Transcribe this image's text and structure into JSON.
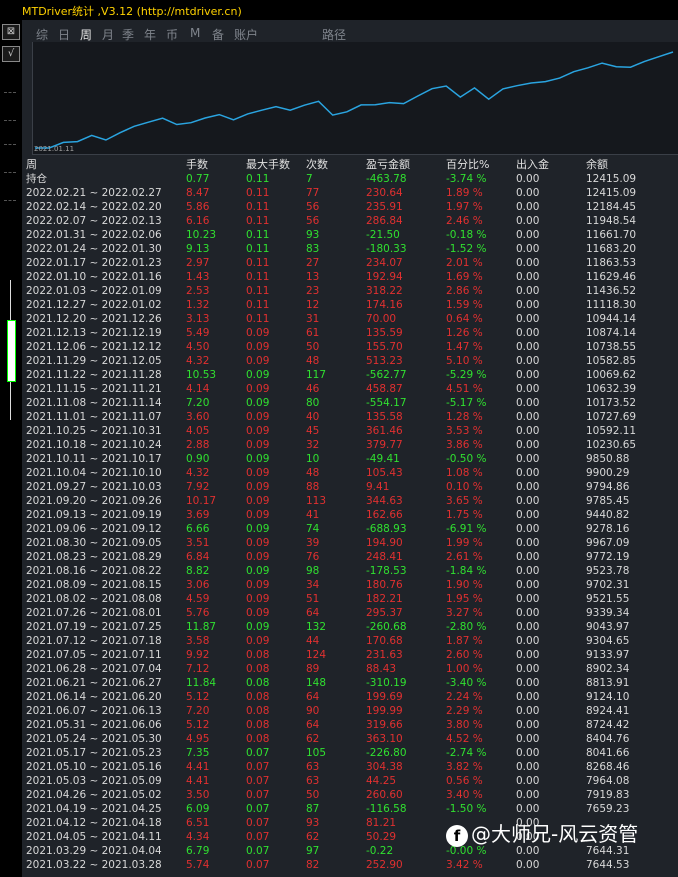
{
  "title": "MTDriver统计 ,V3.12 (http://mtdriver.cn)",
  "tabs": [
    "综",
    "日",
    "周",
    "月",
    "季",
    "年",
    "币",
    "M",
    "备",
    "账户",
    "路径"
  ],
  "active_tab": "周",
  "chart": {
    "x_label": "2021.01.11",
    "line_color": "#2aa4e0",
    "values": [
      7644.53,
      7644.31,
      7919.83,
      7964.08,
      8268.46,
      8041.66,
      8404.76,
      8724.42,
      8924.41,
      9124.1,
      8813.91,
      8902.34,
      9133.97,
      9304.65,
      9043.97,
      9339.34,
      9521.55,
      9702.31,
      9523.78,
      9772.19,
      9967.09,
      9278.16,
      9440.82,
      9785.45,
      9794.86,
      9900.29,
      9850.88,
      10230.65,
      10592.11,
      10727.69,
      10173.52,
      10632.39,
      10069.62,
      10582.85,
      10738.55,
      10874.14,
      10944.14,
      11118.3,
      11436.52,
      11629.46,
      11863.53,
      11683.2,
      11661.7,
      11948.54,
      12184.45,
      12415.09
    ]
  },
  "columns": [
    "周",
    "手数",
    "最大手数",
    "次数",
    "盈亏金额",
    "百分比%",
    "出入金",
    "余额"
  ],
  "holding": {
    "label": "持仓",
    "lots": "0.77",
    "max_lots": "0.11",
    "count": "7",
    "pnl": "-463.78",
    "pct": "-3.74 %",
    "inout": "0.00",
    "balance": "12415.09"
  },
  "rows": [
    {
      "period": "2022.02.21 ~ 2022.02.27",
      "lots": "8.47",
      "max_lots": "0.11",
      "count": "77",
      "pnl": "230.64",
      "pct": "1.89 %",
      "inout": "0.00",
      "balance": "12415.09"
    },
    {
      "period": "2022.02.14 ~ 2022.02.20",
      "lots": "5.86",
      "max_lots": "0.11",
      "count": "56",
      "pnl": "235.91",
      "pct": "1.97 %",
      "inout": "0.00",
      "balance": "12184.45"
    },
    {
      "period": "2022.02.07 ~ 2022.02.13",
      "lots": "6.16",
      "max_lots": "0.11",
      "count": "56",
      "pnl": "286.84",
      "pct": "2.46 %",
      "inout": "0.00",
      "balance": "11948.54"
    },
    {
      "period": "2022.01.31 ~ 2022.02.06",
      "lots": "10.23",
      "max_lots": "0.11",
      "count": "93",
      "pnl": "-21.50",
      "pct": "-0.18 %",
      "inout": "0.00",
      "balance": "11661.70"
    },
    {
      "period": "2022.01.24 ~ 2022.01.30",
      "lots": "9.13",
      "max_lots": "0.11",
      "count": "83",
      "pnl": "-180.33",
      "pct": "-1.52 %",
      "inout": "0.00",
      "balance": "11683.20"
    },
    {
      "period": "2022.01.17 ~ 2022.01.23",
      "lots": "2.97",
      "max_lots": "0.11",
      "count": "27",
      "pnl": "234.07",
      "pct": "2.01 %",
      "inout": "0.00",
      "balance": "11863.53"
    },
    {
      "period": "2022.01.10 ~ 2022.01.16",
      "lots": "1.43",
      "max_lots": "0.11",
      "count": "13",
      "pnl": "192.94",
      "pct": "1.69 %",
      "inout": "0.00",
      "balance": "11629.46"
    },
    {
      "period": "2022.01.03 ~ 2022.01.09",
      "lots": "2.53",
      "max_lots": "0.11",
      "count": "23",
      "pnl": "318.22",
      "pct": "2.86 %",
      "inout": "0.00",
      "balance": "11436.52"
    },
    {
      "period": "2021.12.27 ~ 2022.01.02",
      "lots": "1.32",
      "max_lots": "0.11",
      "count": "12",
      "pnl": "174.16",
      "pct": "1.59 %",
      "inout": "0.00",
      "balance": "11118.30"
    },
    {
      "period": "2021.12.20 ~ 2021.12.26",
      "lots": "3.13",
      "max_lots": "0.11",
      "count": "31",
      "pnl": "70.00",
      "pct": "0.64 %",
      "inout": "0.00",
      "balance": "10944.14"
    },
    {
      "period": "2021.12.13 ~ 2021.12.19",
      "lots": "5.49",
      "max_lots": "0.09",
      "count": "61",
      "pnl": "135.59",
      "pct": "1.26 %",
      "inout": "0.00",
      "balance": "10874.14"
    },
    {
      "period": "2021.12.06 ~ 2021.12.12",
      "lots": "4.50",
      "max_lots": "0.09",
      "count": "50",
      "pnl": "155.70",
      "pct": "1.47 %",
      "inout": "0.00",
      "balance": "10738.55"
    },
    {
      "period": "2021.11.29 ~ 2021.12.05",
      "lots": "4.32",
      "max_lots": "0.09",
      "count": "48",
      "pnl": "513.23",
      "pct": "5.10 %",
      "inout": "0.00",
      "balance": "10582.85"
    },
    {
      "period": "2021.11.22 ~ 2021.11.28",
      "lots": "10.53",
      "max_lots": "0.09",
      "count": "117",
      "pnl": "-562.77",
      "pct": "-5.29 %",
      "inout": "0.00",
      "balance": "10069.62"
    },
    {
      "period": "2021.11.15 ~ 2021.11.21",
      "lots": "4.14",
      "max_lots": "0.09",
      "count": "46",
      "pnl": "458.87",
      "pct": "4.51 %",
      "inout": "0.00",
      "balance": "10632.39"
    },
    {
      "period": "2021.11.08 ~ 2021.11.14",
      "lots": "7.20",
      "max_lots": "0.09",
      "count": "80",
      "pnl": "-554.17",
      "pct": "-5.17 %",
      "inout": "0.00",
      "balance": "10173.52"
    },
    {
      "period": "2021.11.01 ~ 2021.11.07",
      "lots": "3.60",
      "max_lots": "0.09",
      "count": "40",
      "pnl": "135.58",
      "pct": "1.28 %",
      "inout": "0.00",
      "balance": "10727.69"
    },
    {
      "period": "2021.10.25 ~ 2021.10.31",
      "lots": "4.05",
      "max_lots": "0.09",
      "count": "45",
      "pnl": "361.46",
      "pct": "3.53 %",
      "inout": "0.00",
      "balance": "10592.11"
    },
    {
      "period": "2021.10.18 ~ 2021.10.24",
      "lots": "2.88",
      "max_lots": "0.09",
      "count": "32",
      "pnl": "379.77",
      "pct": "3.86 %",
      "inout": "0.00",
      "balance": "10230.65"
    },
    {
      "period": "2021.10.11 ~ 2021.10.17",
      "lots": "0.90",
      "max_lots": "0.09",
      "count": "10",
      "pnl": "-49.41",
      "pct": "-0.50 %",
      "inout": "0.00",
      "balance": "9850.88"
    },
    {
      "period": "2021.10.04 ~ 2021.10.10",
      "lots": "4.32",
      "max_lots": "0.09",
      "count": "48",
      "pnl": "105.43",
      "pct": "1.08 %",
      "inout": "0.00",
      "balance": "9900.29"
    },
    {
      "period": "2021.09.27 ~ 2021.10.03",
      "lots": "7.92",
      "max_lots": "0.09",
      "count": "88",
      "pnl": "9.41",
      "pct": "0.10 %",
      "inout": "0.00",
      "balance": "9794.86"
    },
    {
      "period": "2021.09.20 ~ 2021.09.26",
      "lots": "10.17",
      "max_lots": "0.09",
      "count": "113",
      "pnl": "344.63",
      "pct": "3.65 %",
      "inout": "0.00",
      "balance": "9785.45"
    },
    {
      "period": "2021.09.13 ~ 2021.09.19",
      "lots": "3.69",
      "max_lots": "0.09",
      "count": "41",
      "pnl": "162.66",
      "pct": "1.75 %",
      "inout": "0.00",
      "balance": "9440.82"
    },
    {
      "period": "2021.09.06 ~ 2021.09.12",
      "lots": "6.66",
      "max_lots": "0.09",
      "count": "74",
      "pnl": "-688.93",
      "pct": "-6.91 %",
      "inout": "0.00",
      "balance": "9278.16"
    },
    {
      "period": "2021.08.30 ~ 2021.09.05",
      "lots": "3.51",
      "max_lots": "0.09",
      "count": "39",
      "pnl": "194.90",
      "pct": "1.99 %",
      "inout": "0.00",
      "balance": "9967.09"
    },
    {
      "period": "2021.08.23 ~ 2021.08.29",
      "lots": "6.84",
      "max_lots": "0.09",
      "count": "76",
      "pnl": "248.41",
      "pct": "2.61 %",
      "inout": "0.00",
      "balance": "9772.19"
    },
    {
      "period": "2021.08.16 ~ 2021.08.22",
      "lots": "8.82",
      "max_lots": "0.09",
      "count": "98",
      "pnl": "-178.53",
      "pct": "-1.84 %",
      "inout": "0.00",
      "balance": "9523.78"
    },
    {
      "period": "2021.08.09 ~ 2021.08.15",
      "lots": "3.06",
      "max_lots": "0.09",
      "count": "34",
      "pnl": "180.76",
      "pct": "1.90 %",
      "inout": "0.00",
      "balance": "9702.31"
    },
    {
      "period": "2021.08.02 ~ 2021.08.08",
      "lots": "4.59",
      "max_lots": "0.09",
      "count": "51",
      "pnl": "182.21",
      "pct": "1.95 %",
      "inout": "0.00",
      "balance": "9521.55"
    },
    {
      "period": "2021.07.26 ~ 2021.08.01",
      "lots": "5.76",
      "max_lots": "0.09",
      "count": "64",
      "pnl": "295.37",
      "pct": "3.27 %",
      "inout": "0.00",
      "balance": "9339.34"
    },
    {
      "period": "2021.07.19 ~ 2021.07.25",
      "lots": "11.87",
      "max_lots": "0.09",
      "count": "132",
      "pnl": "-260.68",
      "pct": "-2.80 %",
      "inout": "0.00",
      "balance": "9043.97"
    },
    {
      "period": "2021.07.12 ~ 2021.07.18",
      "lots": "3.58",
      "max_lots": "0.09",
      "count": "44",
      "pnl": "170.68",
      "pct": "1.87 %",
      "inout": "0.00",
      "balance": "9304.65"
    },
    {
      "period": "2021.07.05 ~ 2021.07.11",
      "lots": "9.92",
      "max_lots": "0.08",
      "count": "124",
      "pnl": "231.63",
      "pct": "2.60 %",
      "inout": "0.00",
      "balance": "9133.97"
    },
    {
      "period": "2021.06.28 ~ 2021.07.04",
      "lots": "7.12",
      "max_lots": "0.08",
      "count": "89",
      "pnl": "88.43",
      "pct": "1.00 %",
      "inout": "0.00",
      "balance": "8902.34"
    },
    {
      "period": "2021.06.21 ~ 2021.06.27",
      "lots": "11.84",
      "max_lots": "0.08",
      "count": "148",
      "pnl": "-310.19",
      "pct": "-3.40 %",
      "inout": "0.00",
      "balance": "8813.91"
    },
    {
      "period": "2021.06.14 ~ 2021.06.20",
      "lots": "5.12",
      "max_lots": "0.08",
      "count": "64",
      "pnl": "199.69",
      "pct": "2.24 %",
      "inout": "0.00",
      "balance": "9124.10"
    },
    {
      "period": "2021.06.07 ~ 2021.06.13",
      "lots": "7.20",
      "max_lots": "0.08",
      "count": "90",
      "pnl": "199.99",
      "pct": "2.29 %",
      "inout": "0.00",
      "balance": "8924.41"
    },
    {
      "period": "2021.05.31 ~ 2021.06.06",
      "lots": "5.12",
      "max_lots": "0.08",
      "count": "64",
      "pnl": "319.66",
      "pct": "3.80 %",
      "inout": "0.00",
      "balance": "8724.42"
    },
    {
      "period": "2021.05.24 ~ 2021.05.30",
      "lots": "4.95",
      "max_lots": "0.08",
      "count": "62",
      "pnl": "363.10",
      "pct": "4.52 %",
      "inout": "0.00",
      "balance": "8404.76"
    },
    {
      "period": "2021.05.17 ~ 2021.05.23",
      "lots": "7.35",
      "max_lots": "0.07",
      "count": "105",
      "pnl": "-226.80",
      "pct": "-2.74 %",
      "inout": "0.00",
      "balance": "8041.66"
    },
    {
      "period": "2021.05.10 ~ 2021.05.16",
      "lots": "4.41",
      "max_lots": "0.07",
      "count": "63",
      "pnl": "304.38",
      "pct": "3.82 %",
      "inout": "0.00",
      "balance": "8268.46"
    },
    {
      "period": "2021.05.03 ~ 2021.05.09",
      "lots": "4.41",
      "max_lots": "0.07",
      "count": "63",
      "pnl": "44.25",
      "pct": "0.56 %",
      "inout": "0.00",
      "balance": "7964.08"
    },
    {
      "period": "2021.04.26 ~ 2021.05.02",
      "lots": "3.50",
      "max_lots": "0.07",
      "count": "50",
      "pnl": "260.60",
      "pct": "3.40 %",
      "inout": "0.00",
      "balance": "7919.83"
    },
    {
      "period": "2021.04.19 ~ 2021.04.25",
      "lots": "6.09",
      "max_lots": "0.07",
      "count": "87",
      "pnl": "-116.58",
      "pct": "-1.50 %",
      "inout": "0.00",
      "balance": "7659.23"
    },
    {
      "period": "2021.04.12 ~ 2021.04.18",
      "lots": "6.51",
      "max_lots": "0.07",
      "count": "93",
      "pnl": "81.21",
      "pct": "",
      "inout": "0.00",
      "balance": ""
    },
    {
      "period": "2021.04.05 ~ 2021.04.11",
      "lots": "4.34",
      "max_lots": "0.07",
      "count": "62",
      "pnl": "50.29",
      "pct": "",
      "inout": "0.00",
      "balance": ""
    },
    {
      "period": "2021.03.29 ~ 2021.04.04",
      "lots": "6.79",
      "max_lots": "0.07",
      "count": "97",
      "pnl": "-0.22",
      "pct": "-0.00 %",
      "inout": "0.00",
      "balance": "7644.31"
    },
    {
      "period": "2021.03.22 ~ 2021.03.28",
      "lots": "5.74",
      "max_lots": "0.07",
      "count": "82",
      "pnl": "252.90",
      "pct": "3.42 %",
      "inout": "0.00",
      "balance": "7644.53"
    }
  ],
  "watermark": "@大师兄-风云资管",
  "watermark_icon": "f"
}
